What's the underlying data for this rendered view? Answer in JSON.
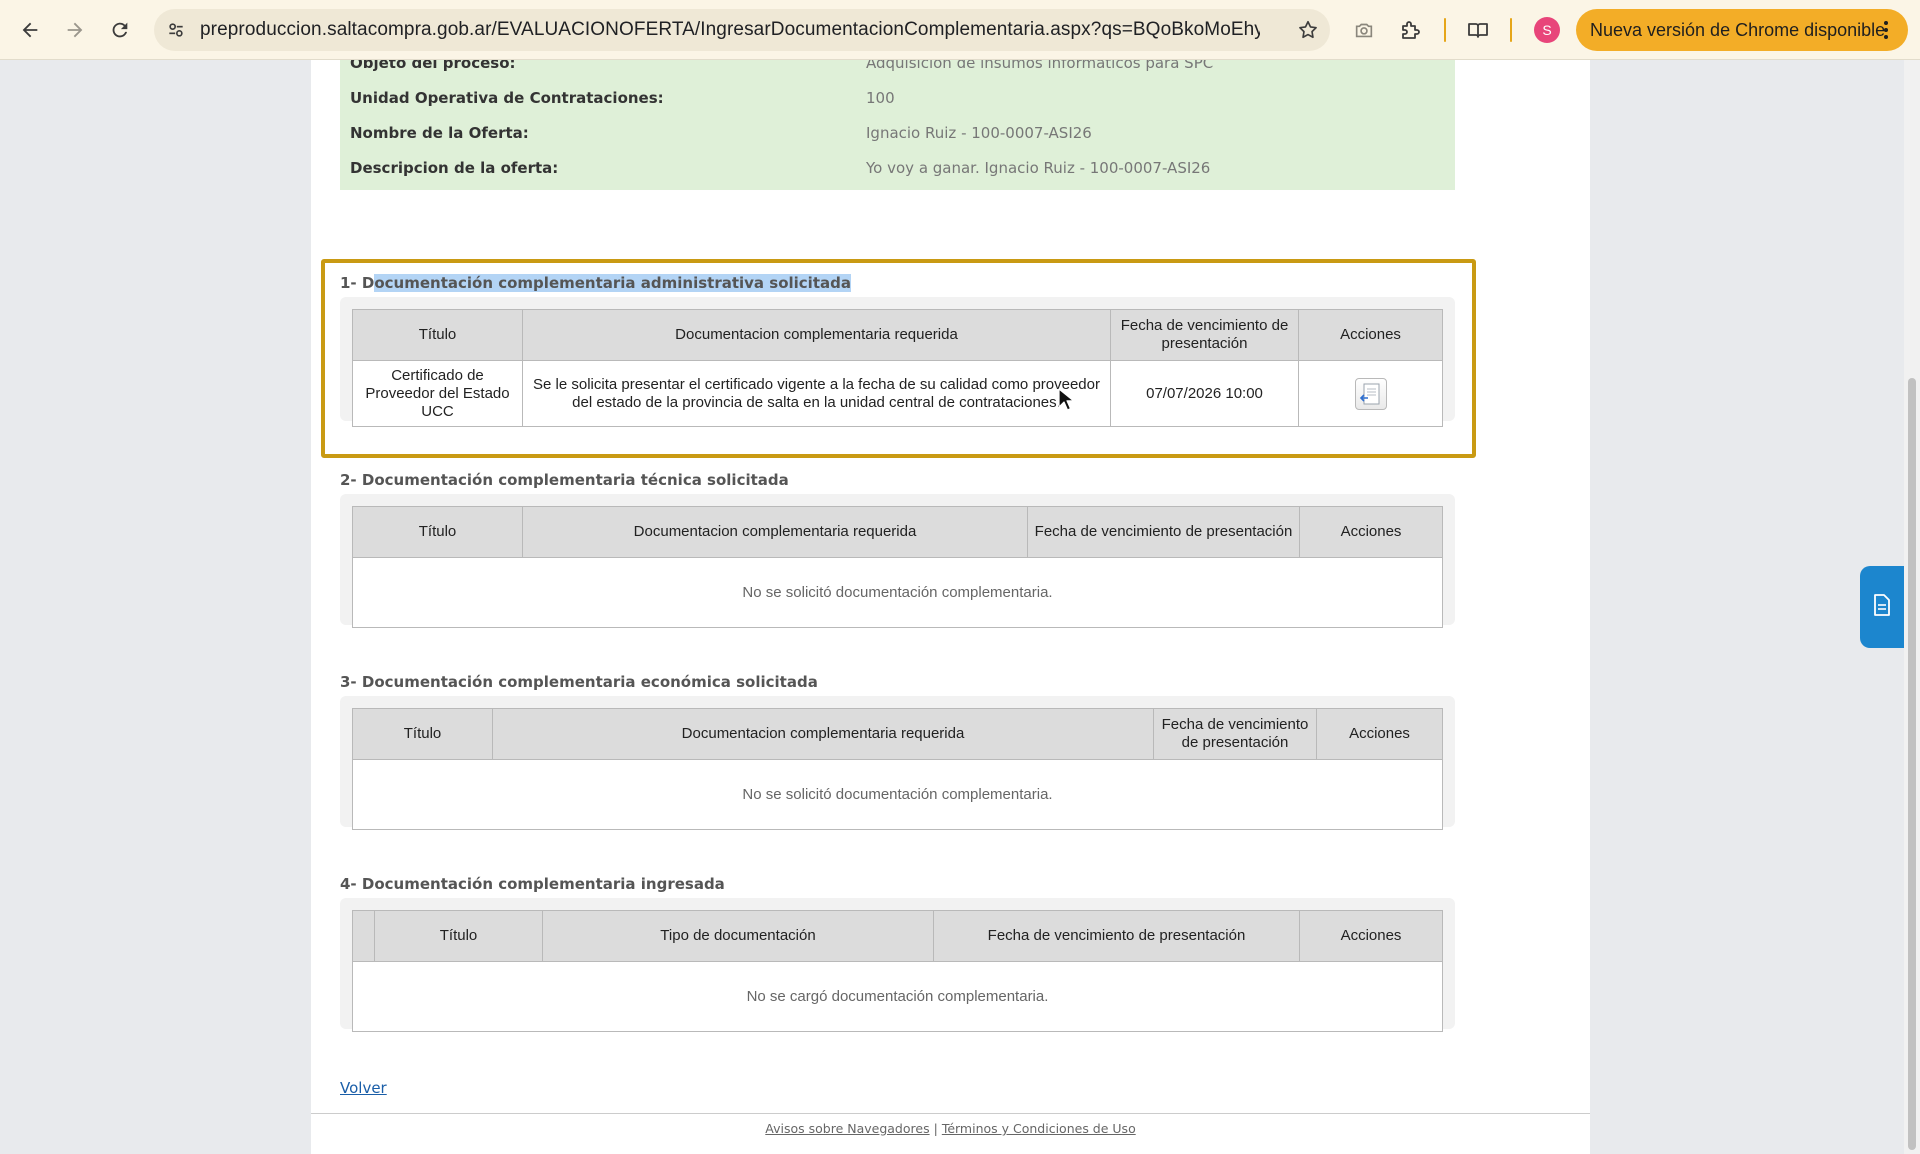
{
  "browser": {
    "url": "preproduccion.saltacompra.gob.ar/EVALUACIONOFERTA/IngresarDocumentacionComplementaria.aspx?qs=BQoBkoMoEhyT0O...",
    "profile_initial": "S",
    "update_label": "Nueva versión de Chrome disponible",
    "icons": [
      "back-icon",
      "forward-icon",
      "reload-icon",
      "site-settings-icon",
      "bookmark-star-icon",
      "camera-icon",
      "extensions-icon",
      "reading-mode-icon",
      "kebab-menu-icon"
    ],
    "accent_color": "#f3ad27"
  },
  "info": {
    "rows": [
      {
        "label": "Objeto del proceso:",
        "value": "Adquisicion de insumos informaticos para SPC"
      },
      {
        "label": "Unidad Operativa de Contrataciones:",
        "value": "100"
      },
      {
        "label": "Nombre de la Oferta:",
        "value": "Ignacio Ruiz - 100-0007-ASI26"
      },
      {
        "label": "Descripcion de la oferta:",
        "value": "Yo voy a ganar. Ignacio Ruiz - 100-0007-ASI26"
      }
    ]
  },
  "sections": [
    {
      "prefix": "1- D",
      "title_selected": "ocumentación complementaria administrativa solicitada",
      "headers": [
        "Título",
        "Documentacion complementaria requerida",
        "Fecha de vencimiento de presentación",
        "Acciones"
      ],
      "row": {
        "titulo": "Certificado de Proveedor del Estado UCC",
        "documentacion": "Se le solicita presentar el certificado vigente a la fecha de su calidad como proveedor del estado de la provincia de salta en la unidad central de contrataciones.",
        "fecha": "07/07/2026 10:00"
      }
    },
    {
      "title": "2- Documentación complementaria técnica solicitada",
      "headers": [
        "Título",
        "Documentacion complementaria requerida",
        "Fecha de vencimiento de presentación",
        "Acciones"
      ],
      "empty": "No se solicitó documentación complementaria."
    },
    {
      "title": "3- Documentación complementaria económica solicitada",
      "headers": [
        "Título",
        "Documentacion complementaria requerida",
        "Fecha de vencimiento de presentación",
        "Acciones"
      ],
      "empty": "No se solicitó documentación complementaria."
    },
    {
      "title": "4- Documentación complementaria ingresada",
      "headers": [
        "",
        "Título",
        "Tipo de documentación",
        "Fecha de vencimiento de presentación",
        "Acciones"
      ],
      "empty": "No se cargó documentación complementaria."
    }
  ],
  "volver": "Volver",
  "footer": {
    "link1": "Avisos sobre Navegadores",
    "separator": "|",
    "link2": "Términos y Condiciones de Uso"
  },
  "colors": {
    "info_bg": "#dff0d8",
    "highlight_border": "#c99a13",
    "selection": "#b3d4f5",
    "side_tab": "#1c86ce"
  }
}
